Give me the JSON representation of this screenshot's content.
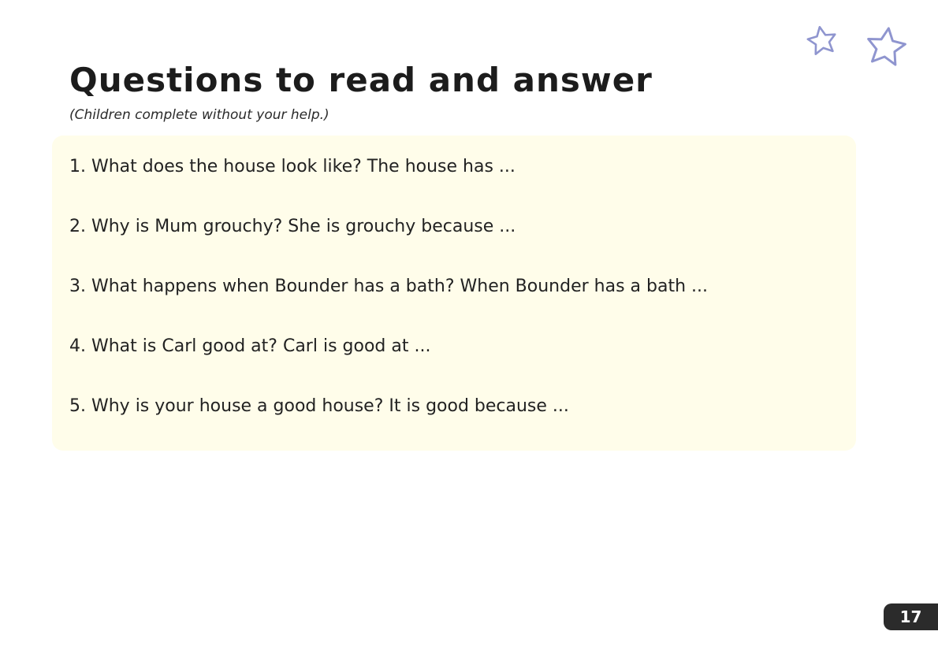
{
  "page": {
    "title": "Questions to read and answer",
    "subtitle": "(Children complete without your help.)",
    "page_number": "17"
  },
  "questions": [
    "1. What does the house look like? The house has ...",
    "2. Why is Mum grouchy? She is grouchy because ...",
    "3. What happens when Bounder has a bath? When Bounder has a bath ...",
    "4. What is Carl good at? Carl is good at ...",
    "5. Why is your house a good house? It is good because ..."
  ],
  "decorations": {
    "icons": [
      "star-outline-icon",
      "star-outline-icon"
    ],
    "star_color": "#8f95cf",
    "panel_color": "#fffdea"
  }
}
